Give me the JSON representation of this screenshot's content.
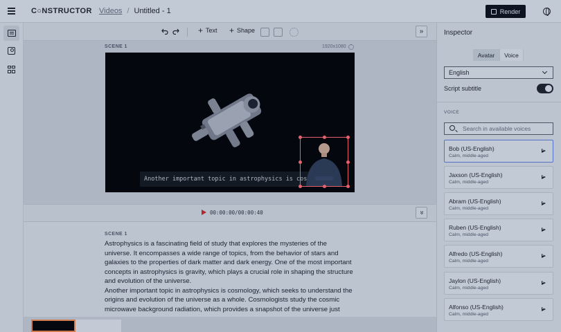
{
  "header": {
    "logo": "C○NSTRUCTOR",
    "breadcrumb_link": "Videos",
    "breadcrumb_sep": "/",
    "breadcrumb_current": "Untitled - 1",
    "render_label": "Render"
  },
  "toolbar": {
    "undo_icon": "undo-icon",
    "redo_icon": "redo-icon",
    "text_label": "Text",
    "shape_label": "Shape"
  },
  "scene": {
    "label": "SCENE 1",
    "resolution": "1920x1080",
    "subtitle": "Another important topic in astrophysics is cosmology"
  },
  "timeline": {
    "timecode": "00:00:00/00:00:40"
  },
  "script": {
    "label": "SCENE 1",
    "paragraph1": "Astrophysics is a fascinating field of study that explores the mysteries of the universe. It encompasses a wide range of topics, from the behavior of stars and galaxies to the properties of dark matter and dark energy. One of the most important concepts in astrophysics is gravity, which plays a crucial role in shaping the structure and evolution of the universe.",
    "paragraph2": "Another important topic in astrophysics is cosmology, which seeks to understand the origins and evolution of the universe as a whole. Cosmologists study the cosmic microwave background radiation, which provides a snapshot of the universe just"
  },
  "inspector": {
    "title": "Inspector",
    "tab_avatar": "Avatar",
    "tab_voice": "Voice",
    "language": "English",
    "subtitle_label": "Script subtitle",
    "subtitle_enabled": true,
    "voice_section": "VOICE",
    "search_placeholder": "Search in available voices",
    "voices": [
      {
        "name": "Bob (US-English)",
        "desc": "Calm, middle-aged"
      },
      {
        "name": "Jaxson (US-English)",
        "desc": "Calm, middle-aged"
      },
      {
        "name": "Abram (US-English)",
        "desc": "Calm, middle-aged"
      },
      {
        "name": "Ruben (US-English)",
        "desc": "Calm, middle-aged"
      },
      {
        "name": "Alfredo (US-English)",
        "desc": "Calm, middle-aged"
      },
      {
        "name": "Jaylon (US-English)",
        "desc": "Calm, middle-aged"
      },
      {
        "name": "Alfonso (US-English)",
        "desc": "Calm, middle-aged"
      }
    ]
  }
}
